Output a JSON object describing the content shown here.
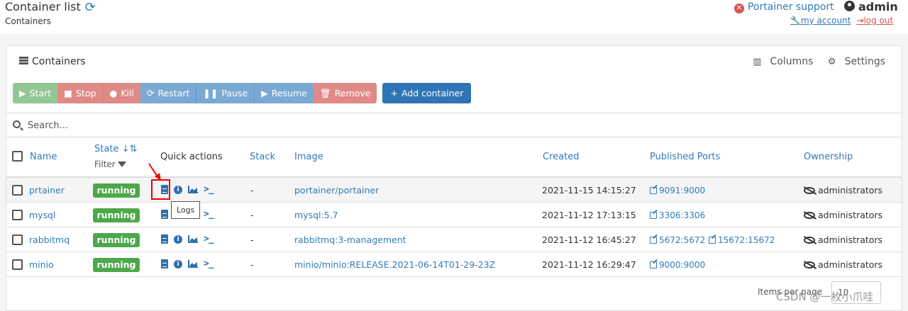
{
  "header": {
    "title": "Container list",
    "breadcrumb": "Containers",
    "support_label": "Portainer support",
    "user": "admin",
    "my_account": "my account",
    "logout": "log out"
  },
  "panel": {
    "title": "Containers",
    "columns_label": "Columns",
    "settings_label": "Settings"
  },
  "toolbar": {
    "start": "Start",
    "stop": "Stop",
    "kill": "Kill",
    "restart": "Restart",
    "pause": "Pause",
    "resume": "Resume",
    "remove": "Remove",
    "add": "Add container"
  },
  "search": {
    "placeholder": "Search..."
  },
  "table": {
    "headers": {
      "name": "Name",
      "state": "State",
      "filter": "Filter",
      "quick_actions": "Quick actions",
      "stack": "Stack",
      "image": "Image",
      "created": "Created",
      "ports": "Published Ports",
      "ownership": "Ownership"
    },
    "rows": [
      {
        "name": "prtainer",
        "state": "running",
        "stack": "-",
        "image": "portainer/portainer",
        "created": "2021-11-15 14:15:27",
        "ports": [
          "9091:9000"
        ],
        "ownership": "administrators"
      },
      {
        "name": "mysql",
        "state": "running",
        "stack": "-",
        "image": "mysql:5.7",
        "created": "2021-11-12 17:13:15",
        "ports": [
          "3306:3306"
        ],
        "ownership": "administrators"
      },
      {
        "name": "rabbitmq",
        "state": "running",
        "stack": "-",
        "image": "rabbitmq:3-management",
        "created": "2021-11-12 16:45:27",
        "ports": [
          "5672:5672",
          "15672:15672"
        ],
        "ownership": "administrators"
      },
      {
        "name": "minio",
        "state": "running",
        "stack": "-",
        "image": "minio/minio:RELEASE.2021-06-14T01-29-23Z",
        "created": "2021-11-12 16:29:47",
        "ports": [
          "9000:9000"
        ],
        "ownership": "administrators"
      }
    ]
  },
  "tooltip": "Logs",
  "pager": {
    "label": "Items per page",
    "value": "10"
  },
  "watermark": "CSDN @一枚小爪哇",
  "colors": {
    "accent": "#337ab7",
    "running": "#4ea84b",
    "danger": "#d9534f"
  }
}
